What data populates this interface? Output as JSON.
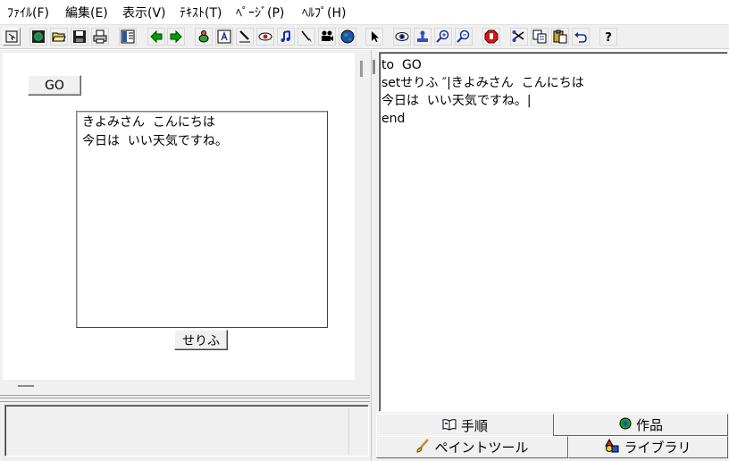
{
  "menu": [
    "ﾌｧｲﾙ(F)",
    "編集(E)",
    "表示(V)",
    "ﾃｷｽﾄ(T)",
    "ﾍﾟｰｼﾞ(P)",
    "ﾍﾙﾌﾟ(H)"
  ],
  "page": {
    "go_button": "GO",
    "textbox_lines": [
      "きよみさん  こんにちは",
      "今日は  いい天気ですね。"
    ],
    "serifu_button": "せりふ"
  },
  "editor": {
    "lines": [
      "to  GO",
      "setせりふ ″|きよみさん  こんにちは",
      "今日は  いい天気ですね。|",
      "end"
    ]
  },
  "tabs": {
    "procedure": "手順",
    "works": "作品",
    "paint_tool": "ペイントツール",
    "library": "ライブラリ"
  },
  "icons": {
    "toolbar": [
      "pointer-mode-icon",
      "world-icon",
      "open-folder-icon",
      "save-disk-icon",
      "print-icon",
      "page-layout-icon",
      "back-arrow-icon",
      "forward-arrow-icon",
      "turtle-icon",
      "text-box-icon",
      "pen-icon",
      "eye-shape-icon",
      "music-note-icon",
      "brush-icon",
      "movie-camera-icon",
      "globe-icon",
      "select-arrow-icon",
      "eye-icon",
      "stamp-icon",
      "zoom-in-icon",
      "zoom-out-icon",
      "stop-hand-icon",
      "cut-icon",
      "copy-icon",
      "paste-icon",
      "undo-icon",
      "help-icon"
    ]
  },
  "colors": {
    "chrome": "#f0f0f0",
    "arrow_green": "#00a000",
    "stop_red": "#d01818"
  }
}
